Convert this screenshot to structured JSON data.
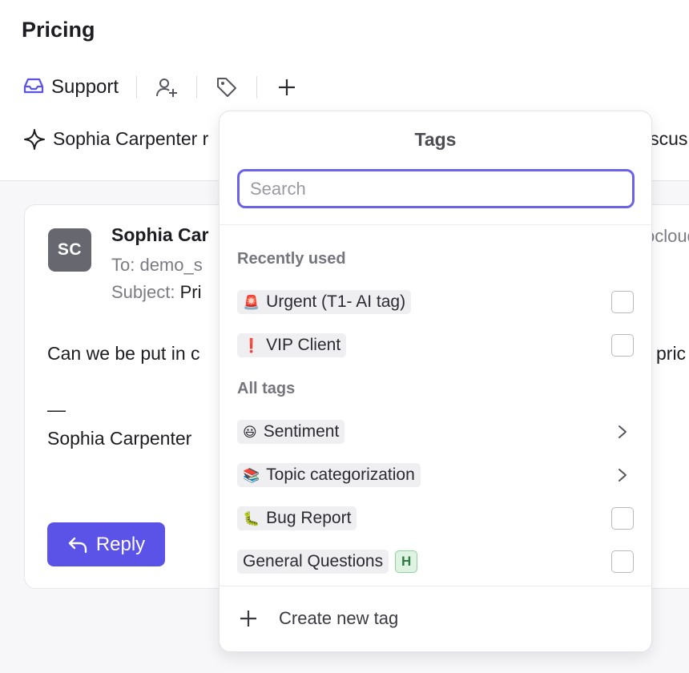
{
  "header": {
    "title": "Pricing",
    "inbox_label": "Support",
    "activity_text": "Sophia Carpenter r",
    "activity_right": "iscus"
  },
  "message": {
    "avatar_initials": "SC",
    "sender_name": "Sophia Car",
    "to_label": "To: demo_s",
    "subject_label": "Subject:",
    "subject_value": "Pri",
    "email_right": "ocloud",
    "body_text": "Can we be put in c",
    "body_right": "pric",
    "signature_dash": "—",
    "signature_name": "Sophia Carpenter",
    "reply_label": "Reply"
  },
  "tags_popover": {
    "title": "Tags",
    "search_placeholder": "Search",
    "search_value": "",
    "recently_used_header": "Recently used",
    "all_tags_header": "All tags",
    "recently_used": [
      {
        "emoji": "🚨",
        "label": "Urgent (T1- AI tag)"
      },
      {
        "emoji": "❗",
        "label": "VIP Client"
      }
    ],
    "all_tags": [
      {
        "emoji": "😃",
        "label": "Sentiment"
      },
      {
        "emoji": "📚",
        "label": "Topic categorization"
      },
      {
        "emoji": "🐛",
        "label": "Bug Report"
      },
      {
        "emoji": "",
        "label": "General Questions",
        "badge": "H"
      }
    ],
    "create_label": "Create new tag"
  },
  "colors": {
    "accent": "#5b52e8",
    "search_border": "#6a63e6",
    "badge_green": "#2f7a42",
    "avatar_bg": "#66676f"
  }
}
